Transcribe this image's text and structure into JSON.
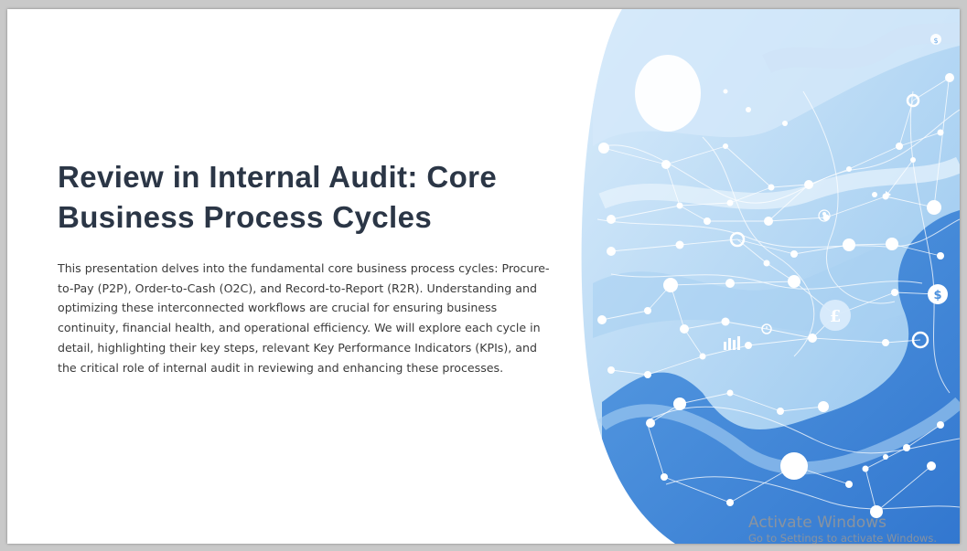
{
  "slide": {
    "title": "Review in Internal Audit: Core Business Process Cycles",
    "body": "This presentation delves into the fundamental core business process cycles: Procure-to-Pay (P2P), Order-to-Cash (O2C), and Record-to-Report (R2R). Understanding and optimizing these interconnected workflows are crucial for ensuring business continuity, financial health, and operational efficiency. We will explore each cycle in detail, highlighting their key steps, relevant Key Performance Indicators (KPIs), and the critical role of internal audit in reviewing and enhancing these processes."
  },
  "artwork": {
    "icons": [
      "dollar-icon",
      "euro-icon",
      "dollar-icon",
      "bar-chart-icon",
      "clock-icon",
      "user-icon",
      "hash-icon"
    ],
    "colors": {
      "light_blue": "#bcdcf5",
      "mid_blue": "#7fb6e9",
      "deep_blue": "#3f86d8"
    }
  },
  "watermark": {
    "title": "Activate Windows",
    "subtitle": "Go to Settings to activate Windows."
  }
}
